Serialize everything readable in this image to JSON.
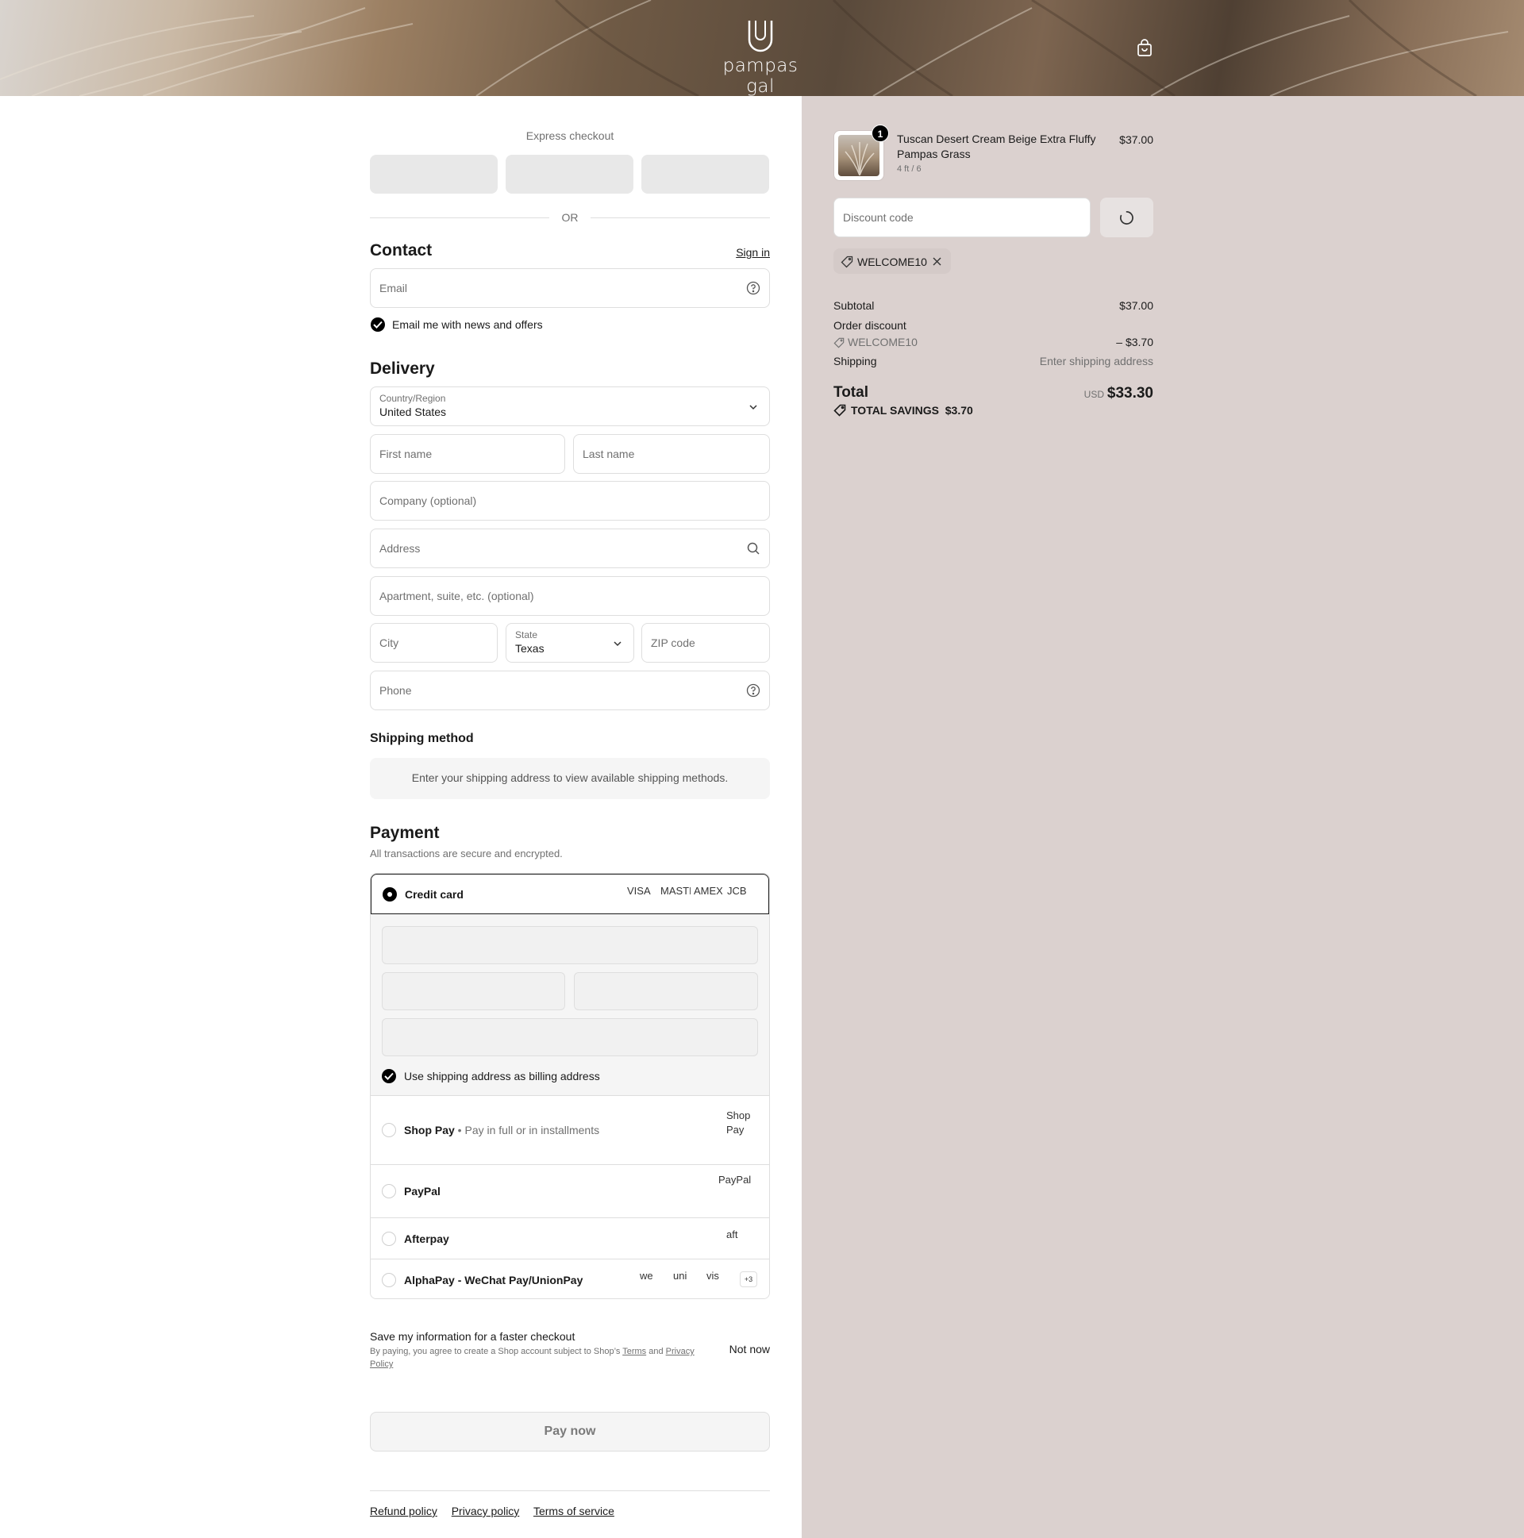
{
  "brand": {
    "name": "pampas gal"
  },
  "icons": {
    "cart": "shopping-bag-icon",
    "help": "question-circle-icon",
    "search": "search-icon",
    "chevron": "chevron-down-icon",
    "tag": "tag-icon",
    "close": "close-icon",
    "spinner": "spinner-icon",
    "check": "check-icon"
  },
  "express": {
    "title": "Express checkout",
    "divider": "OR"
  },
  "contact": {
    "title": "Contact",
    "sign_in": "Sign in",
    "email_placeholder": "Email",
    "news_label": "Email me with news and offers"
  },
  "delivery": {
    "title": "Delivery",
    "country_label": "Country/Region",
    "country_value": "United States",
    "first_name": "First name",
    "last_name": "Last name",
    "company": "Company (optional)",
    "address": "Address",
    "apartment": "Apartment, suite, etc. (optional)",
    "city": "City",
    "state_label": "State",
    "state_value": "Texas",
    "zip": "ZIP code",
    "phone": "Phone"
  },
  "shipping": {
    "title": "Shipping method",
    "message": "Enter your shipping address to view available shipping methods."
  },
  "payment": {
    "title": "Payment",
    "subtitle": "All transactions are secure and encrypted.",
    "credit_card": "Credit card",
    "card_brands": [
      "VISA",
      "MASTER",
      "AMEX",
      "JCB"
    ],
    "billing_same": "Use shipping address as billing address",
    "shop_pay": "Shop Pay",
    "shop_pay_sub": "Pay in full or in installments",
    "shop_pay_logo": "Shop Pay",
    "paypal": "PayPal",
    "paypal_logo": "PayPal",
    "afterpay": "Afterpay",
    "afterpay_logo": "aft",
    "alphapay": "AlphaPay - WeChat Pay/UnionPay",
    "alphapay_logos": [
      "we",
      "uni",
      "vis"
    ],
    "alphapay_more": "+3"
  },
  "save_info": {
    "title": "Save my information for a faster checkout",
    "text_prefix": "By paying, you agree to create a Shop account subject to Shop’s",
    "terms": "Terms",
    "and": "and",
    "privacy": "Privacy Policy",
    "not_now": "Not now"
  },
  "pay_now": "Pay now",
  "footer": {
    "links": [
      "Refund policy",
      "Privacy policy",
      "Terms of service"
    ]
  },
  "summary": {
    "product": {
      "name": "Tuscan Desert Cream Beige Extra Fluffy Pampas Grass",
      "variant": "4 ft / 6",
      "price": "$37.00",
      "quantity": "1"
    },
    "discount_placeholder": "Discount code",
    "applied_code": "WELCOME10",
    "subtotal_label": "Subtotal",
    "subtotal_value": "$37.00",
    "order_discount_label": "Order discount",
    "order_discount_code": "WELCOME10",
    "order_discount_value": "– $3.70",
    "shipping_label": "Shipping",
    "shipping_value": "Enter shipping address",
    "total_label": "Total",
    "currency": "USD",
    "total_value": "$33.30",
    "savings_label": "TOTAL SAVINGS",
    "savings_value": "$3.70"
  },
  "colors": {
    "summary_bg": "#dbd1cf",
    "accent": "#000000",
    "border": "#dedede"
  }
}
